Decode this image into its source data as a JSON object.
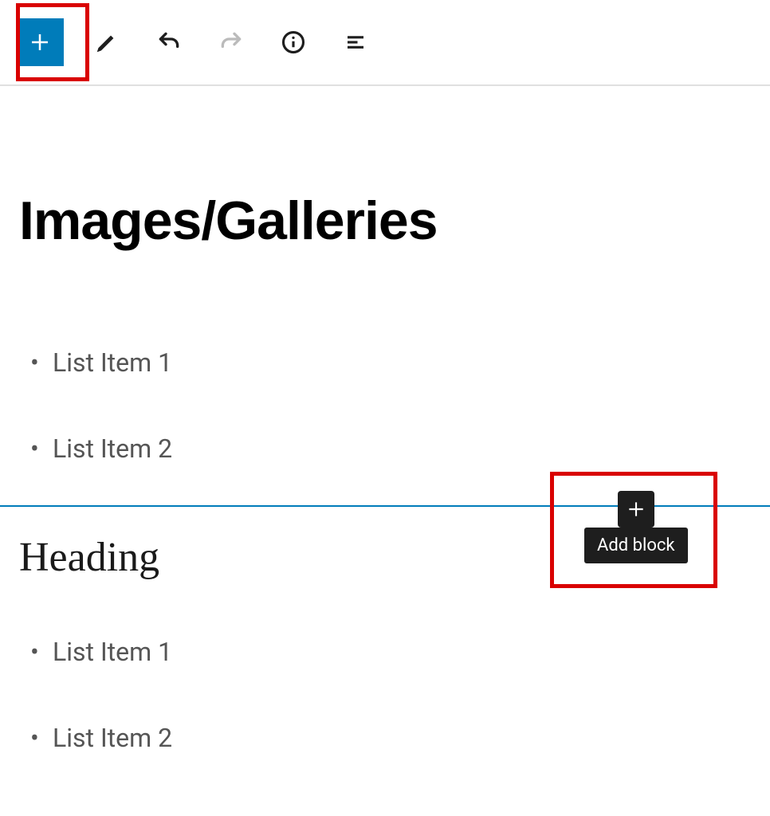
{
  "page": {
    "title": "Images/Galleries"
  },
  "lists": {
    "first": [
      "List Item 1",
      "List Item 2"
    ],
    "second": [
      "List Item 1",
      "List Item 2"
    ]
  },
  "heading": "Heading",
  "tooltip": {
    "addBlock": "Add block"
  },
  "colors": {
    "accent": "#007cba",
    "highlight": "#d90000",
    "dark": "#1e1e1e"
  }
}
